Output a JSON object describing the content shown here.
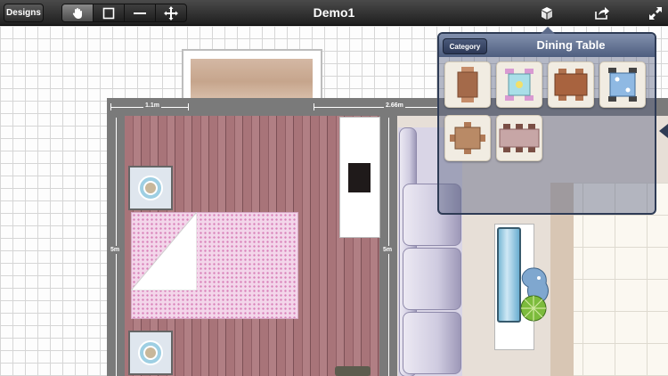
{
  "toolbar": {
    "designs_label": "Designs",
    "title": "Demo1",
    "tools": [
      "hand-icon",
      "rectangle-icon",
      "line-icon",
      "move-icon"
    ],
    "right_icons": [
      "cube-icon",
      "share-icon",
      "fullscreen-icon"
    ]
  },
  "plan": {
    "dimensions": [
      "1.1m",
      "2.66m",
      "5m",
      "5m"
    ]
  },
  "popover": {
    "category_label": "Category",
    "title": "Dining Table",
    "items": [
      "dining-table-1",
      "dining-table-2",
      "dining-table-3",
      "dining-table-4",
      "dining-table-5",
      "dining-table-6"
    ]
  },
  "colors": {
    "toolbar": "#2b2b2b",
    "popover": "#4e5e7f",
    "wall": "#7a7a7a",
    "wood_floor": "#a87479",
    "bed": "#f3d6ea"
  }
}
